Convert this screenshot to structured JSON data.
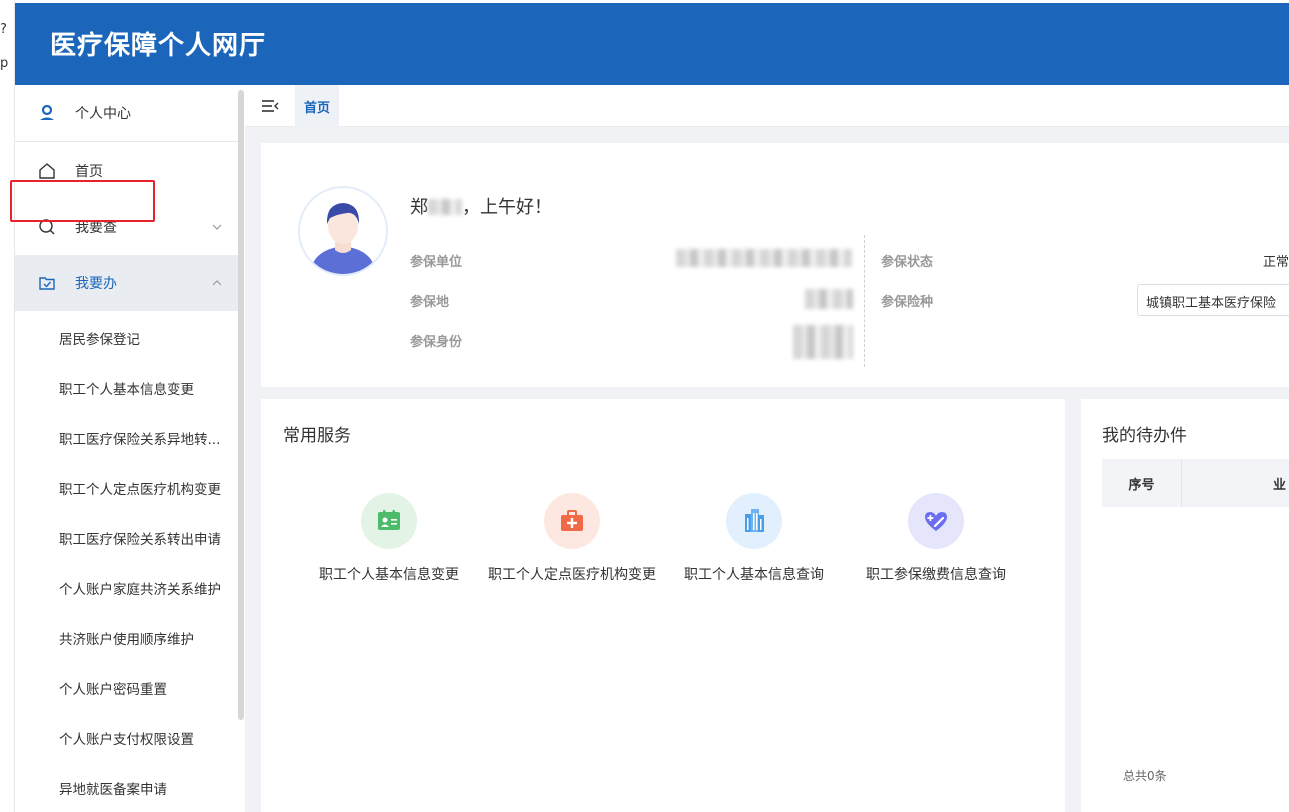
{
  "app": {
    "title": "医疗保障个人网厅",
    "edge_glyphs": [
      "?",
      "p"
    ]
  },
  "sidebar": {
    "profile_label": "个人中心",
    "menu": [
      {
        "label": "首页",
        "icon": "home-icon"
      },
      {
        "label": "我要查",
        "icon": "search-icon",
        "expanded": false
      },
      {
        "label": "我要办",
        "icon": "folder-check-icon",
        "expanded": true,
        "active": true
      }
    ],
    "sub_items": [
      "居民参保登记",
      "职工个人基本信息变更",
      "职工医疗保险关系异地转...",
      "职工个人定点医疗机构变更",
      "职工医疗保险关系转出申请",
      "个人账户家庭共济关系维护",
      "共济账户使用顺序维护",
      "个人账户密码重置",
      "个人账户支付权限设置",
      "异地就医备案申请"
    ]
  },
  "topbar": {
    "tab_label": "首页"
  },
  "profile": {
    "name_visible_first": "郑",
    "name_visible_last": "",
    "greeting_suffix": "，上午好！",
    "fields_left": [
      {
        "label": "参保单位"
      },
      {
        "label": "参保地"
      },
      {
        "label": "参保身份"
      }
    ],
    "fields_right": [
      {
        "label": "参保状态",
        "value": "正常"
      },
      {
        "label": "参保险种",
        "value": "城镇职工基本医疗保险"
      }
    ]
  },
  "services": {
    "title": "常用服务",
    "items": [
      {
        "name": "职工个人基本信息变更",
        "icon": "id-card-icon",
        "bg": "#e3f4e6",
        "color": "#4cbb6a"
      },
      {
        "name": "职工个人定点医疗机构变更",
        "icon": "medical-kit-icon",
        "bg": "#fde8e1",
        "color": "#f06a47"
      },
      {
        "name": "职工个人基本信息查询",
        "icon": "building-icon",
        "bg": "#e1f0fc",
        "color": "#4a9ee8"
      },
      {
        "name": "职工参保缴费信息查询",
        "icon": "heart-plus-icon",
        "bg": "#e5e6fb",
        "color": "#6b6ef0"
      }
    ]
  },
  "todo": {
    "title": "我的待办件",
    "columns": [
      "序号",
      "业"
    ],
    "total_text": "总共0条"
  },
  "colors": {
    "brand": "#1b66ba",
    "highlight": "#e8212b"
  }
}
